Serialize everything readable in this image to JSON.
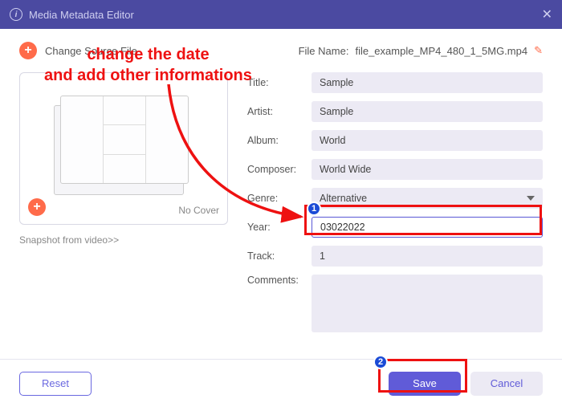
{
  "window": {
    "title": "Media Metadata Editor"
  },
  "toolbar": {
    "change_source": "Change Source File",
    "file_name_label": "File Name:",
    "file_name": "file_example_MP4_480_1_5MG.mp4"
  },
  "cover": {
    "no_cover": "No Cover",
    "snapshot": "Snapshot from video>>"
  },
  "fields": {
    "title": {
      "label": "Title:",
      "value": "Sample"
    },
    "artist": {
      "label": "Artist:",
      "value": "Sample"
    },
    "album": {
      "label": "Album:",
      "value": "World"
    },
    "composer": {
      "label": "Composer:",
      "value": "World Wide"
    },
    "genre": {
      "label": "Genre:",
      "value": "Alternative"
    },
    "year": {
      "label": "Year:",
      "value": "03022022"
    },
    "track": {
      "label": "Track:",
      "value": "1"
    },
    "comments": {
      "label": "Comments:",
      "value": ""
    }
  },
  "buttons": {
    "reset": "Reset",
    "save": "Save",
    "cancel": "Cancel"
  },
  "annotation": {
    "text_line1": "change the date",
    "text_line2": "and add other informations",
    "badge1": "1",
    "badge2": "2"
  }
}
